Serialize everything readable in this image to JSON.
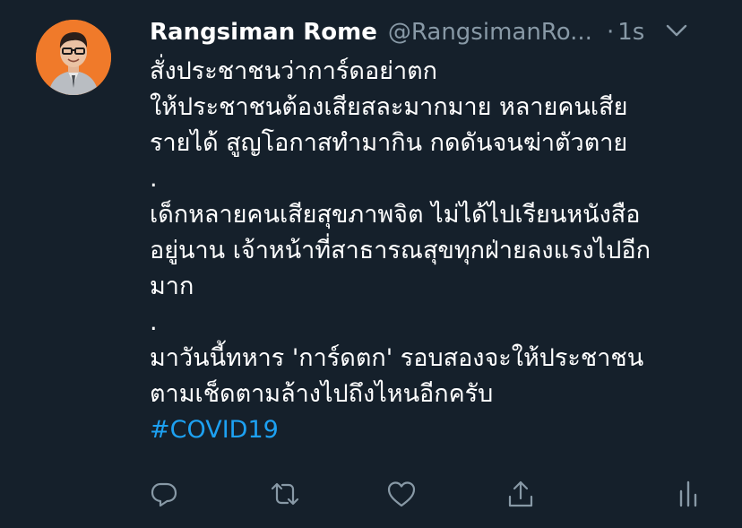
{
  "user": {
    "display_name": "Rangsiman Rome",
    "handle": "@RangsimanRo...",
    "separator": "·",
    "time": "1s"
  },
  "tweet": {
    "lines": [
      "สั่งประชาชนว่าการ์ดอย่าตก",
      "ให้ประชาชนต้องเสียสละมากมาย หลายคนเสีย",
      "รายได้ สูญโอกาสทำมากิน กดดันจนฆ่าตัวตาย",
      ".",
      "เด็กหลายคนเสียสุขภาพจิต ไม่ได้ไปเรียนหนังสือ",
      "อยู่นาน เจ้าหน้าที่สาธารณสุขทุกฝ่ายลงแรงไปอีก",
      "มาก",
      ".",
      "มาวันนี้ทหาร 'การ์ดตก' รอบสองจะให้ประชาชน",
      "ตามเช็ดตามล้างไปถึงไหนอีกครับ"
    ],
    "hashtag": "#COVID19"
  },
  "icons": {
    "more": "chevron-down-icon",
    "reply": "reply-icon",
    "retweet": "retweet-icon",
    "like": "heart-icon",
    "share": "share-icon",
    "analytics": "analytics-icon"
  },
  "colors": {
    "background": "#15202b",
    "text": "#ffffff",
    "secondary": "#8899a6",
    "link": "#1da1f2",
    "avatar_bg": "#f07a2a"
  }
}
